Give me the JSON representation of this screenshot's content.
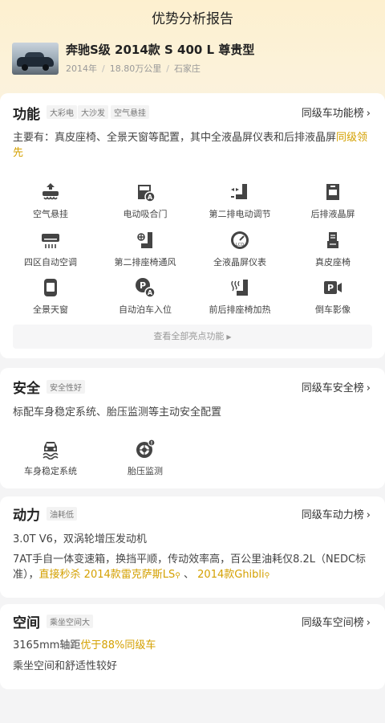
{
  "nav": {
    "title": "优势分析报告"
  },
  "car": {
    "name": "奔驰S级 2014款 S 400 L 尊贵型",
    "year": "2014年",
    "mileage": "18.80万公里",
    "city": "石家庄"
  },
  "features": {
    "title": "功能",
    "tags": [
      "大彩电",
      "大沙发",
      "空气悬挂"
    ],
    "rank_link": "同级车功能榜",
    "desc_prefix": "主要有：真皮座椅、全景天窗等配置，其中全液晶屏仪表和后排液晶屏",
    "desc_highlight": "同级领先",
    "items": [
      {
        "label": "空气悬挂",
        "icon": "air-suspension-icon"
      },
      {
        "label": "电动吸合门",
        "icon": "soft-close-door-icon"
      },
      {
        "label": "第二排电动调节",
        "icon": "power-seat-icon"
      },
      {
        "label": "后排液晶屏",
        "icon": "rear-screen-icon"
      },
      {
        "label": "四区自动空调",
        "icon": "climate-control-icon"
      },
      {
        "label": "第二排座椅通风",
        "icon": "seat-ventilation-icon"
      },
      {
        "label": "全液晶屏仪表",
        "icon": "lcd-gauge-icon"
      },
      {
        "label": "真皮座椅",
        "icon": "leather-seat-icon"
      },
      {
        "label": "全景天窗",
        "icon": "panoramic-roof-icon"
      },
      {
        "label": "自动泊车入位",
        "icon": "auto-parking-icon"
      },
      {
        "label": "前后排座椅加热",
        "icon": "seat-heating-icon"
      },
      {
        "label": "倒车影像",
        "icon": "reverse-camera-icon"
      }
    ],
    "more_label": "查看全部亮点功能"
  },
  "safety": {
    "title": "安全",
    "tag": "安全性好",
    "rank_link": "同级车安全榜",
    "desc": "标配车身稳定系统、胎压监测等主动安全配置",
    "items": [
      {
        "label": "车身稳定系统",
        "icon": "stability-control-icon"
      },
      {
        "label": "胎压监测",
        "icon": "tire-pressure-icon"
      }
    ]
  },
  "power": {
    "title": "动力",
    "tag": "油耗低",
    "rank_link": "同级车动力榜",
    "engine": "3.0T V6，双涡轮增压发动机",
    "trans_prefix": "7AT手自一体变速箱，换挡平顺，传动效率高，百公里油耗仅8.2L（NEDC标准），",
    "trans_highlight": "直接秒杀",
    "competitor1": "2014款雷克萨斯LS",
    "comma": "、",
    "competitor2": "2014款Ghibli"
  },
  "space": {
    "title": "空间",
    "tag": "乘坐空间大",
    "rank_link": "同级车空间榜",
    "wheelbase": "3165mm轴距",
    "wheelbase_highlight": "优于88%同级车",
    "comfort": "乘坐空间和舒适性较好"
  },
  "colors": {
    "accent": "#d4a000",
    "header_bg": "#fdf0cf",
    "icon": "#444444"
  }
}
